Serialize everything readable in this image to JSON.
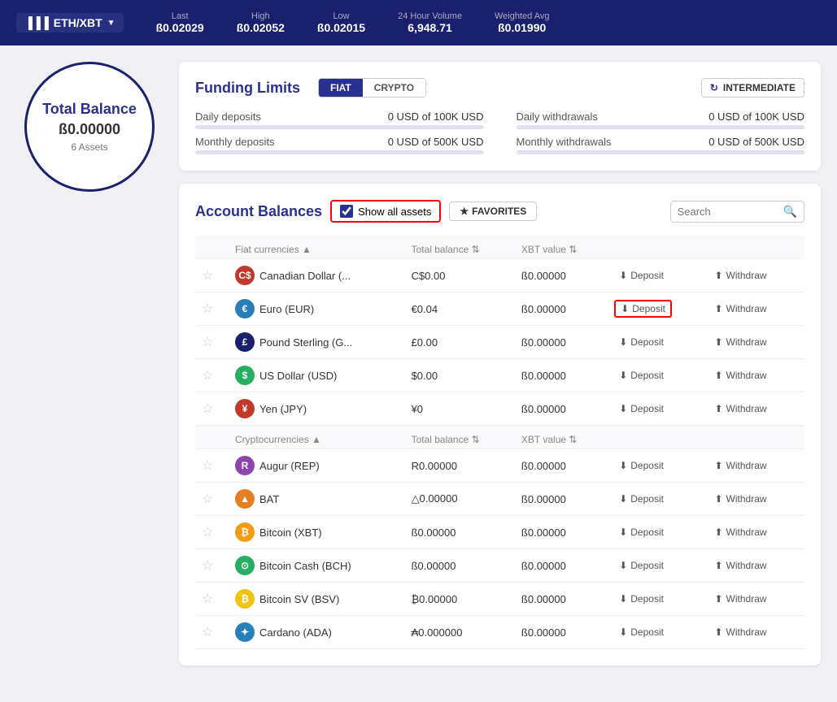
{
  "topbar": {
    "ticker": "ETH/XBT",
    "stats": [
      {
        "label": "Last",
        "value": "ß0.02029"
      },
      {
        "label": "High",
        "value": "ß0.02052"
      },
      {
        "label": "Low",
        "value": "ß0.02015"
      },
      {
        "label": "24 Hour Volume",
        "value": "6,948.71"
      },
      {
        "label": "Weighted Avg",
        "value": "ß0.01990"
      }
    ]
  },
  "balance": {
    "title": "Total Balance",
    "amount": "ß0.00000",
    "assets": "6 Assets"
  },
  "funding": {
    "title": "Funding Limits",
    "toggle": {
      "fiat": "FIAT",
      "crypto": "CRYPTO",
      "active": "FIAT"
    },
    "intermediate_label": "INTERMEDIATE",
    "rows": [
      {
        "label": "Daily deposits",
        "value": "0 USD of 100K USD",
        "progress": 0
      },
      {
        "label": "Daily withdrawals",
        "value": "0 USD of 100K USD",
        "progress": 0
      },
      {
        "label": "Monthly deposits",
        "value": "0 USD of 500K USD",
        "progress": 0
      },
      {
        "label": "Monthly withdrawals",
        "value": "0 USD of 500K USD",
        "progress": 0
      }
    ]
  },
  "account_balances": {
    "title": "Account Balances",
    "show_all_label": "Show all assets",
    "favorites_label": "FAVORITES",
    "search_placeholder": "Search",
    "fiat_section": "Fiat currencies ▲",
    "fiat_col_total": "Total balance",
    "fiat_col_xbt": "XBT value",
    "crypto_section": "Cryptocurrencies ▲",
    "crypto_col_total": "Total balance",
    "crypto_col_xbt": "XBT value",
    "fiat_currencies": [
      {
        "name": "Canadian Dollar (...",
        "icon_bg": "#c0392b",
        "icon_text": "C$",
        "total": "C$0.00",
        "xbt": "ß0.00000",
        "deposit_highlight": false
      },
      {
        "name": "Euro (EUR)",
        "icon_bg": "#2980b9",
        "icon_text": "€",
        "total": "€0.04",
        "xbt": "ß0.00000",
        "deposit_highlight": true
      },
      {
        "name": "Pound Sterling (G...",
        "icon_bg": "#1a1f6e",
        "icon_text": "£",
        "total": "£0.00",
        "xbt": "ß0.00000",
        "deposit_highlight": false
      },
      {
        "name": "US Dollar (USD)",
        "icon_bg": "#27ae60",
        "icon_text": "$",
        "total": "$0.00",
        "xbt": "ß0.00000",
        "deposit_highlight": false
      },
      {
        "name": "Yen (JPY)",
        "icon_bg": "#c0392b",
        "icon_text": "¥",
        "total": "¥0",
        "xbt": "ß0.00000",
        "deposit_highlight": false
      }
    ],
    "cryptocurrencies": [
      {
        "name": "Augur (REP)",
        "icon_bg": "#8e44ad",
        "icon_text": "R",
        "total": "R0.00000",
        "xbt": "ß0.00000"
      },
      {
        "name": "BAT",
        "icon_bg": "#e67e22",
        "icon_text": "▲",
        "total": "△0.00000",
        "xbt": "ß0.00000"
      },
      {
        "name": "Bitcoin (XBT)",
        "icon_bg": "#f39c12",
        "icon_text": "₿",
        "total": "ß0.00000",
        "xbt": "ß0.00000"
      },
      {
        "name": "Bitcoin Cash (BCH)",
        "icon_bg": "#27ae60",
        "icon_text": "⊙",
        "total": "ß0.00000",
        "xbt": "ß0.00000"
      },
      {
        "name": "Bitcoin SV (BSV)",
        "icon_bg": "#f1c40f",
        "icon_text": "₿",
        "total": "₿0.00000",
        "xbt": "ß0.00000"
      },
      {
        "name": "Cardano (ADA)",
        "icon_bg": "#2980b9",
        "icon_text": "✦",
        "total": "₳0.000000",
        "xbt": "ß0.00000"
      }
    ],
    "deposit_label": "Deposit",
    "withdraw_label": "Withdraw"
  }
}
